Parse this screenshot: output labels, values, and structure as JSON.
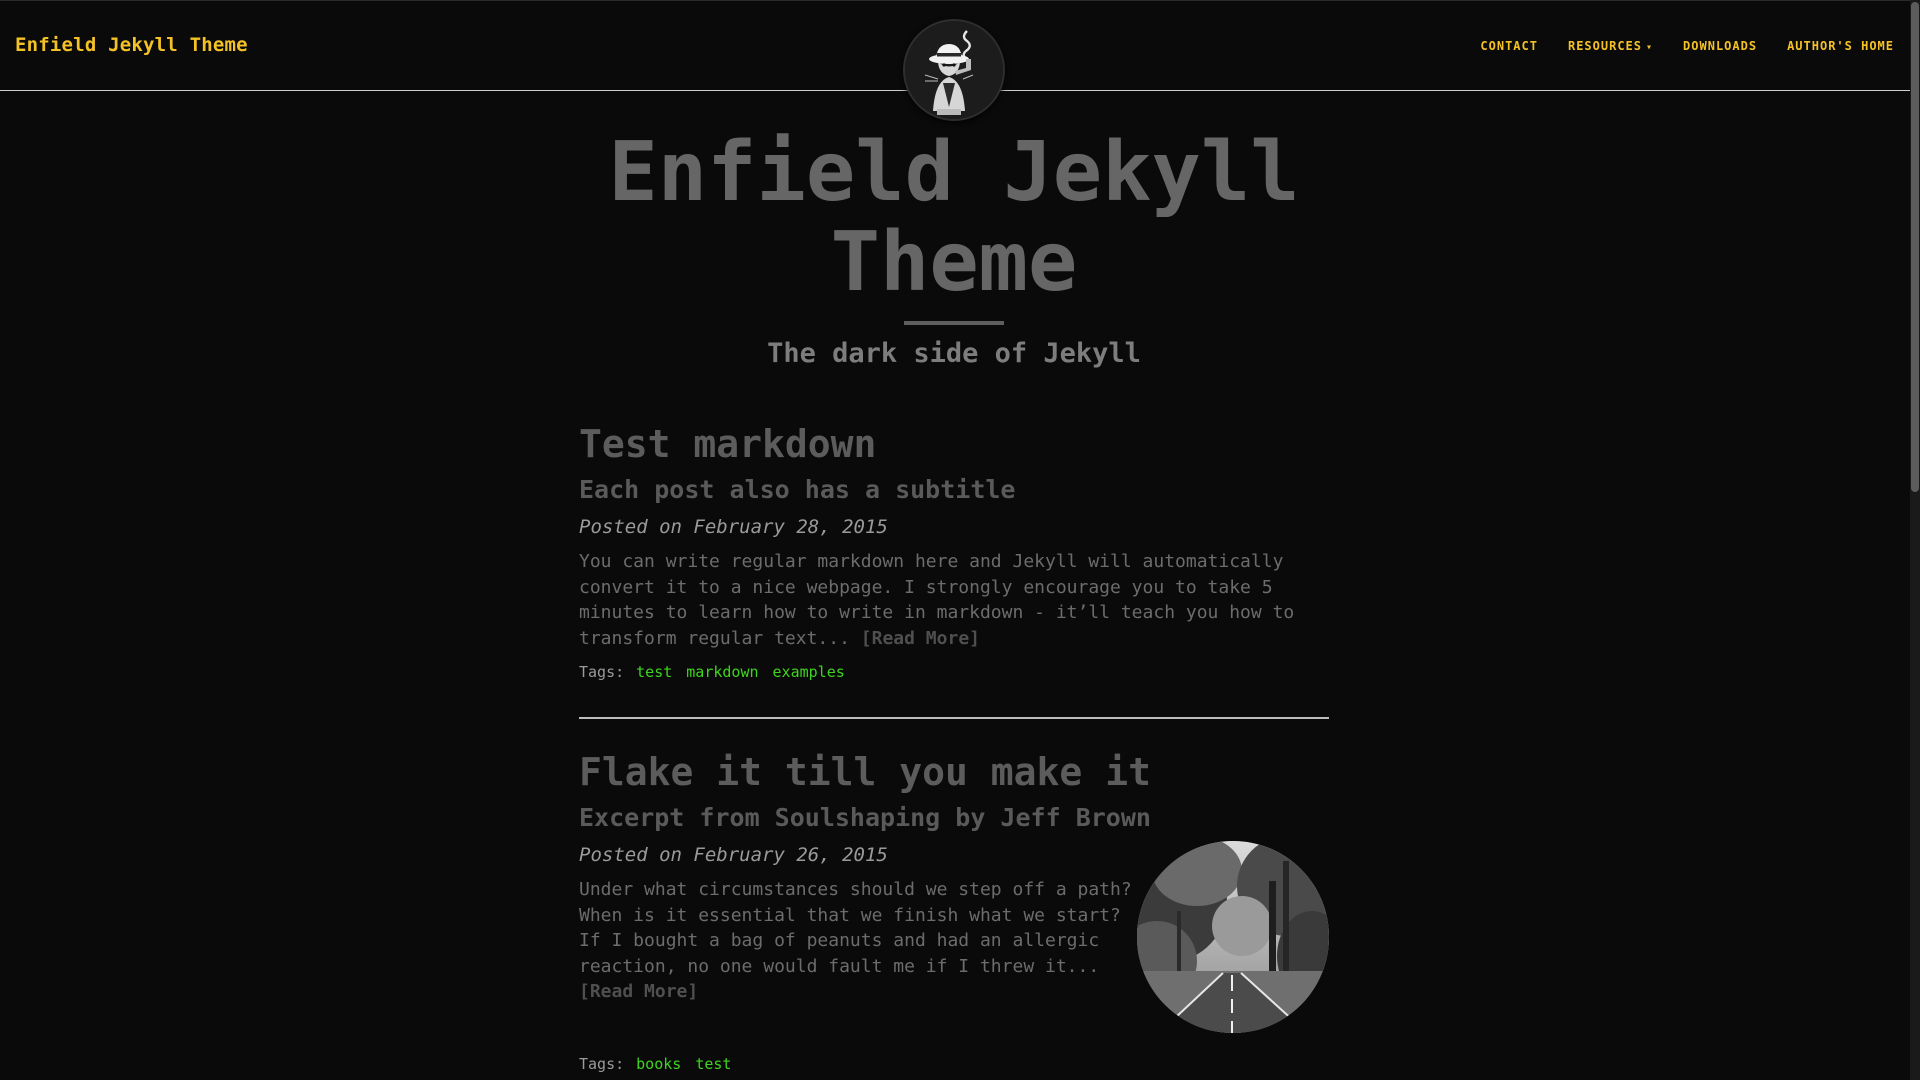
{
  "navbar": {
    "brand": "Enfield Jekyll Theme",
    "links": [
      {
        "label": "CONTACT"
      },
      {
        "label": "RESOURCES",
        "caret": "▾"
      },
      {
        "label": "DOWNLOADS"
      },
      {
        "label": "AUTHOR'S HOME"
      }
    ]
  },
  "hero": {
    "title": "Enfield Jekyll Theme",
    "subtitle": "The dark side of Jekyll"
  },
  "posts": [
    {
      "title": "Test markdown",
      "subtitle": "Each post also has a subtitle",
      "meta": "Posted on February 28, 2015",
      "excerpt": "You can write regular markdown here and Jekyll will automatically convert it to a nice webpage. I strongly encourage you to take 5 minutes to learn how to write in markdown - it’ll teach you how to transform regular text...",
      "read_more": "[Read More]",
      "tags_label": "Tags:",
      "tags": [
        "test",
        "markdown",
        "examples"
      ]
    },
    {
      "title": "Flake it till you make it",
      "subtitle": "Excerpt from Soulshaping by Jeff Brown",
      "meta": "Posted on February 26, 2015",
      "excerpt": "Under what circumstances should we step off a path? When is it essential that we finish what we start? If I bought a bag of peanuts and had an allergic reaction, no one would fault me if I threw it...",
      "read_more": "[Read More]",
      "tags_label": "Tags:",
      "tags": [
        "books",
        "test"
      ]
    }
  ],
  "colors": {
    "background": "#0a0a0a",
    "accent": "#f5c226",
    "tag": "#3ed41e",
    "heading": "#5c5c5c"
  },
  "icons": {
    "avatar": "detective-avatar-icon",
    "thumbnail": "forest-road-image"
  }
}
